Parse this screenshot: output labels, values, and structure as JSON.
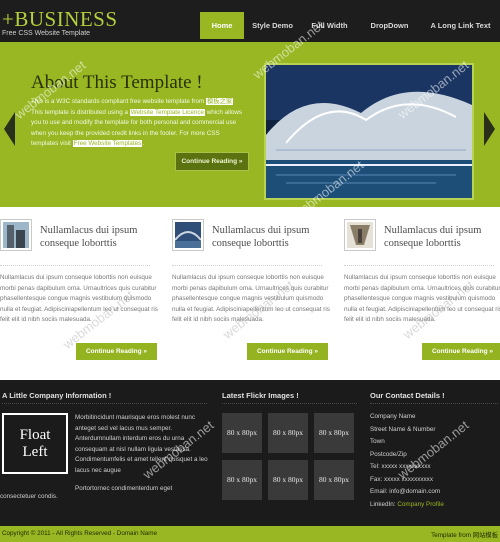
{
  "header": {
    "logo": "+BUSINESS",
    "tagline": "Free CSS Website Template",
    "nav": [
      {
        "label": "Home",
        "active": true
      },
      {
        "label": "Style Demo",
        "active": false
      },
      {
        "label": "Full Width",
        "active": false
      },
      {
        "label": "DropDown",
        "active": false
      },
      {
        "label": "A Long Link Text",
        "active": false
      }
    ]
  },
  "hero": {
    "title": "About This Template !",
    "text": {
      "p1_start": "This is a W3C standards compliant free website template from ",
      "p1_link": "模板之家",
      "p1_mid": " This template is distributed using a ",
      "p1_link2": "Website Template Licence",
      "p1_end": " which allows you to use and modify the template for both personal and commercial use when you keep the provided credit links in the footer. For more CSS templates visit ",
      "p1_link3": "Free Website Templates",
      "p1_tail": "."
    },
    "button": "Continue Reading »",
    "prev_icon": "chevron-left-icon",
    "next_icon": "chevron-right-icon"
  },
  "features": [
    {
      "title": "Nullamlacus dui ipsum conseque loborttis",
      "text": "Nullamlacus dui ipsum conseque loborttis non euisque morbi penas dapibulum orna. Urnaultrices quis curabitur phasellentesque congue magnis vestibulum quismodo nulla et feugiat. Adipisciniapellentum leo ut consequat ris felit elit id nibh sociis malesuada.",
      "button": "Continue Reading »"
    },
    {
      "title": "Nullamlacus dui ipsum conseque loborttis",
      "text": "Nullamlacus dui ipsum conseque loborttis non euisque morbi penas dapibulum orna. Urnaultrices quis curabitur phasellentesque congue magnis vestibulum quismodo nulla et feugiat. Adipisciniapellentum leo ut consequat ris felit elit id nibh sociis malesuada.",
      "button": "Continue Reading »"
    },
    {
      "title": "Nullamlacus dui ipsum conseque loborttis",
      "text": "Nullamlacus dui ipsum conseque loborttis non euisque morbi penas dapibulum orna. Urnaultrices quis curabitur phasellentesque congue magnis vestibulum quismodo nulla et feugiat. Adipisciniapellentum leo ut consequat ris felit elit id nibh sociis malesuada.",
      "button": "Continue Reading »"
    }
  ],
  "footer": {
    "about": {
      "heading": "A Little Company Information !",
      "float_line1": "Float",
      "float_line2": "Left",
      "text": "Morbitincidunt maurisque eros molest nunc anteget sed vel lacus mus semper. Anterdumnullam interdum eros du urna consequam at nisl nullam ligula vestassa. Condimentumfelis et amet tellent quisquet a leo lacus nec augue",
      "text2": "Portortornec condimenterdum eget",
      "tail": "consectetuer condis."
    },
    "flickr": {
      "heading": "Latest Flickr Images !",
      "items": [
        "80 x 80px",
        "80 x 80px",
        "80 x 80px",
        "80 x 80px",
        "80 x 80px",
        "80 x 80px"
      ]
    },
    "contact": {
      "heading": "Our Contact Details !",
      "company": "Company Name",
      "street": "Street Name & Number",
      "town": "Town",
      "postcode": "Postcode/Zip",
      "tel": "Tel: xxxxx xxxxxxxxxx",
      "fax": "Fax: xxxxx xxxxxxxxxx",
      "email_label": "Email: ",
      "email": "info@domain.com",
      "linkedin_label": "LinkedIn: ",
      "linkedin": "Company Profile"
    }
  },
  "bottom": {
    "left": "Copyright © 2011 - All Rights Reserved - Domain Name",
    "right": "Template from 网站模板"
  },
  "watermark": "webmoban.net",
  "colors": {
    "accent": "#98b723",
    "dark": "#1b1b1b",
    "button_dark": "#5b7210"
  }
}
